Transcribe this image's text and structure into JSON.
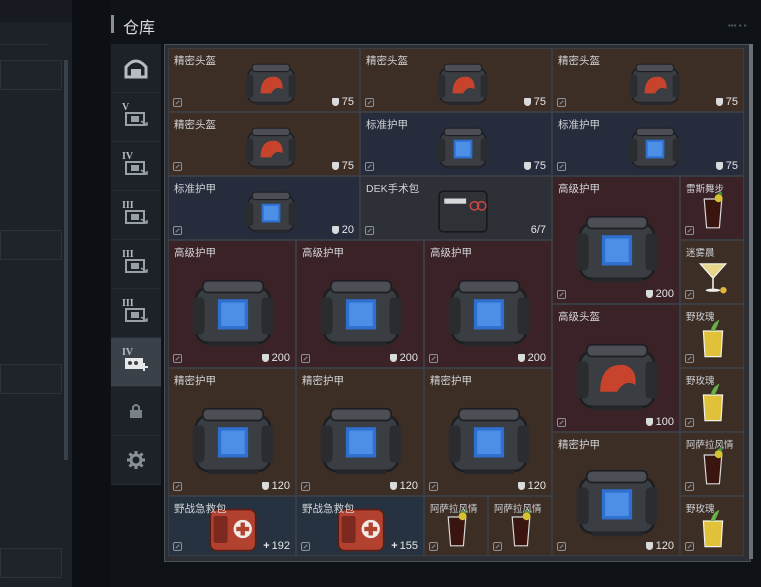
{
  "window": {
    "title": "仓库"
  },
  "sidebar": {
    "tabs": [
      {
        "icon": "helmet-vault-icon",
        "roman": ""
      },
      {
        "icon": "container-v-icon",
        "roman": "V"
      },
      {
        "icon": "container-iv-icon",
        "roman": "IV"
      },
      {
        "icon": "container-iii-icon",
        "roman": "III"
      },
      {
        "icon": "container-iii-b-icon",
        "roman": "III"
      },
      {
        "icon": "container-iii-c-icon",
        "roman": "III"
      },
      {
        "icon": "container-iv-add-icon",
        "roman": "IV"
      },
      {
        "icon": "lock-icon",
        "roman": ""
      },
      {
        "icon": "gear-icon",
        "roman": ""
      }
    ],
    "active_index": 6
  },
  "inventory": {
    "colors": {
      "brown": "#3d2e25",
      "navy": "#262c3c",
      "maroon": "#3b2227",
      "blue": "#263240",
      "accent_red": "#c8432b",
      "accent_blue": "#2f6fd0"
    },
    "items": [
      {
        "name": "精密头盔",
        "value": "75",
        "kind": "helmet",
        "icon": "shield"
      },
      {
        "name": "精密头盔",
        "value": "75",
        "kind": "helmet",
        "icon": "shield"
      },
      {
        "name": "精密头盔",
        "value": "75",
        "kind": "helmet",
        "icon": "shield"
      },
      {
        "name": "精密头盔",
        "value": "75",
        "kind": "helmet",
        "icon": "shield"
      },
      {
        "name": "标准护甲",
        "value": "75",
        "kind": "armor",
        "icon": "shield"
      },
      {
        "name": "标准护甲",
        "value": "75",
        "kind": "armor",
        "icon": "shield"
      },
      {
        "name": "标准护甲",
        "value": "20",
        "kind": "armor",
        "icon": "shield"
      },
      {
        "name": "DEK手术包",
        "value": "6/7",
        "kind": "surgery",
        "icon": ""
      },
      {
        "name": "高级护甲",
        "value": "200",
        "kind": "armor",
        "icon": "shield"
      },
      {
        "name": "雷斯舞步",
        "value": "",
        "kind": "drink-dark",
        "icon": ""
      },
      {
        "name": "迷雾晨",
        "value": "",
        "kind": "drink-cocktail",
        "icon": ""
      },
      {
        "name": "高级护甲",
        "value": "200",
        "kind": "armor",
        "icon": "shield"
      },
      {
        "name": "高级护甲",
        "value": "200",
        "kind": "armor",
        "icon": "shield"
      },
      {
        "name": "高级护甲",
        "value": "200",
        "kind": "armor",
        "icon": "shield"
      },
      {
        "name": "高级头盔",
        "value": "100",
        "kind": "helmet",
        "icon": "shield"
      },
      {
        "name": "野玫瑰",
        "value": "",
        "kind": "drink-yellow",
        "icon": ""
      },
      {
        "name": "精密护甲",
        "value": "120",
        "kind": "armor",
        "icon": "shield"
      },
      {
        "name": "精密护甲",
        "value": "120",
        "kind": "armor",
        "icon": "shield"
      },
      {
        "name": "精密护甲",
        "value": "120",
        "kind": "armor",
        "icon": "shield"
      },
      {
        "name": "野玫瑰",
        "value": "",
        "kind": "drink-yellow",
        "icon": ""
      },
      {
        "name": "阿萨拉风情",
        "value": "",
        "kind": "drink-dark",
        "icon": ""
      },
      {
        "name": "精密护甲",
        "value": "120",
        "kind": "armor",
        "icon": "shield"
      },
      {
        "name": "野战急救包",
        "value": "192",
        "kind": "medkit",
        "icon": "plus"
      },
      {
        "name": "野战急救包",
        "value": "155",
        "kind": "medkit",
        "icon": "plus"
      },
      {
        "name": "阿萨拉风情",
        "value": "",
        "kind": "drink-dark",
        "icon": ""
      },
      {
        "name": "阿萨拉风情",
        "value": "",
        "kind": "drink-dark",
        "icon": ""
      },
      {
        "name": "野玫瑰",
        "value": "",
        "kind": "drink-yellow",
        "icon": ""
      }
    ]
  }
}
